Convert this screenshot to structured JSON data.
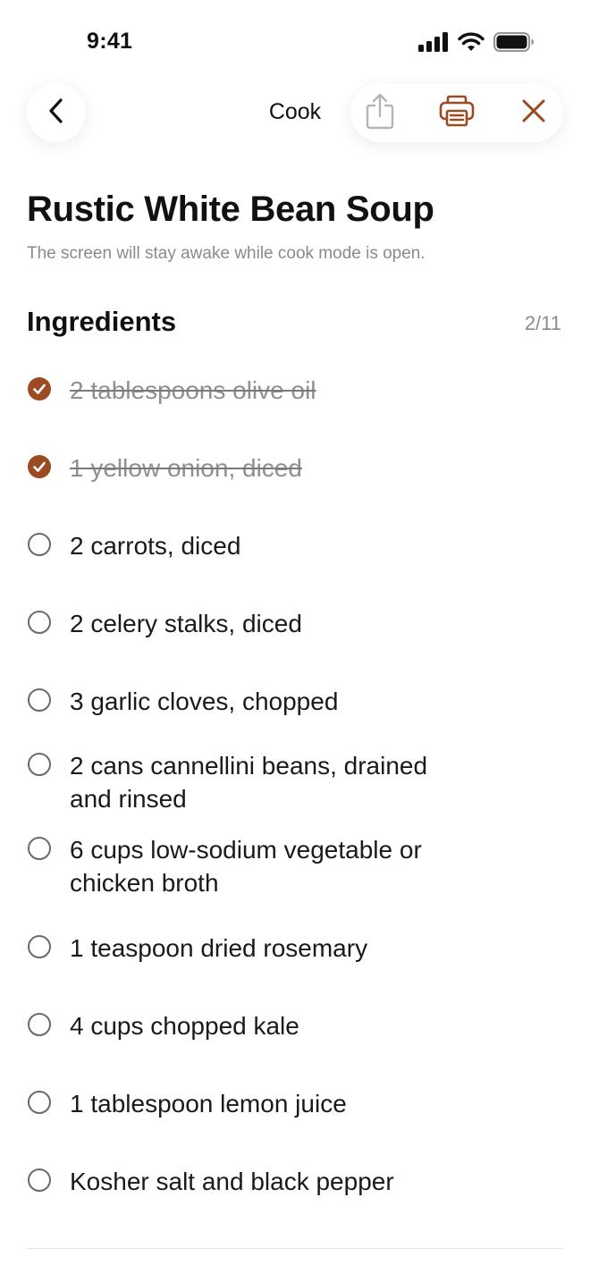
{
  "status_bar": {
    "time": "9:41"
  },
  "nav": {
    "title": "Cook"
  },
  "colors": {
    "accent": "#9a4b22",
    "muted": "#8a8a8a"
  },
  "recipe": {
    "title": "Rustic White Bean Soup",
    "note": "The screen will stay awake while cook mode is open."
  },
  "ingredients": {
    "heading": "Ingredients",
    "count": "2/11",
    "items": [
      {
        "text": "2 tablespoons olive oil",
        "checked": true
      },
      {
        "text": "1 yellow onion, diced",
        "checked": true
      },
      {
        "text": "2 carrots, diced",
        "checked": false
      },
      {
        "text": "2 celery stalks, diced",
        "checked": false
      },
      {
        "text": "3 garlic cloves, chopped",
        "checked": false
      },
      {
        "text": "2 cans cannellini beans, drained and rinsed",
        "checked": false
      },
      {
        "text": "6 cups low-sodium vegetable or chicken broth",
        "checked": false
      },
      {
        "text": "1 teaspoon dried rosemary",
        "checked": false
      },
      {
        "text": "4 cups chopped kale",
        "checked": false
      },
      {
        "text": "1 tablespoon lemon juice",
        "checked": false
      },
      {
        "text": "Kosher salt and black pepper",
        "checked": false
      }
    ]
  },
  "icons": {
    "back": "chevron-left-icon",
    "share": "share-icon",
    "print": "printer-icon",
    "close": "close-icon",
    "signal": "cellular-signal-icon",
    "wifi": "wifi-icon",
    "battery": "battery-icon"
  }
}
